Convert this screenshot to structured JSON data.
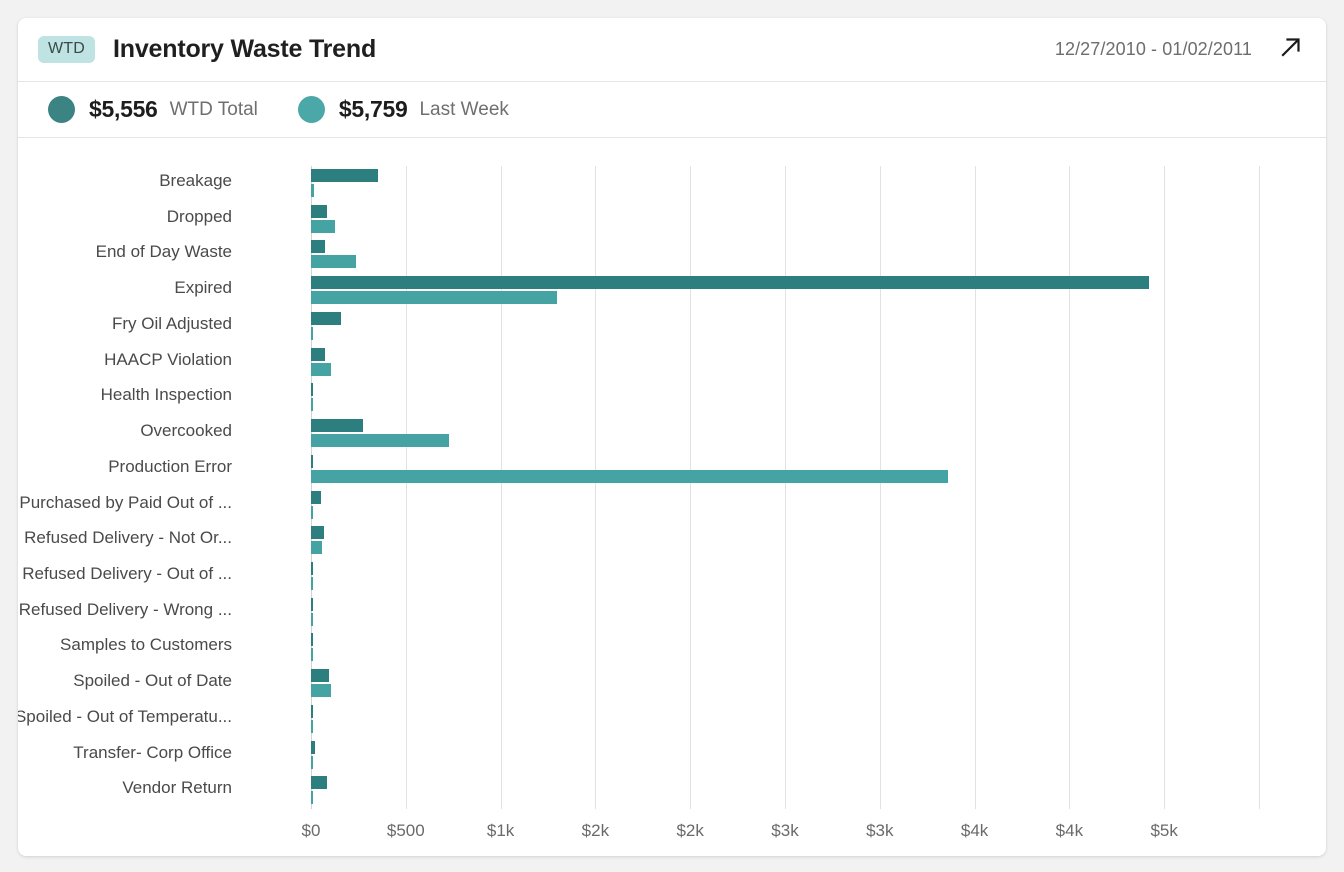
{
  "header": {
    "badge": "WTD",
    "title": "Inventory Waste Trend",
    "date_range": "12/27/2010 - 01/02/2011",
    "expand_icon": "arrow-up-right-icon"
  },
  "legend": [
    {
      "value": "$5,556",
      "label": "WTD Total",
      "color": "#3c8383",
      "icon": "legend-dot-icon"
    },
    {
      "value": "$5,759",
      "label": "Last Week",
      "color": "#4ca8a8",
      "icon": "legend-dot-icon"
    }
  ],
  "colors": {
    "wtd_bar": "#2d7f7f",
    "prev_bar": "#46a3a3",
    "badge_bg": "#bfe2e2",
    "gridline": "#e2e2e2"
  },
  "chart_data": {
    "type": "bar",
    "orientation": "horizontal",
    "title": "Inventory Waste Trend",
    "xlabel": "",
    "ylabel": "",
    "xlim": [
      0,
      5000
    ],
    "grid": true,
    "legend_position": "top-left",
    "tick_values": [
      0,
      500,
      1000,
      1500,
      2000,
      2500,
      3000,
      3500,
      4000,
      4500,
      5000
    ],
    "tick_labels": [
      "$0",
      "$500",
      "$1k",
      "$2k",
      "$2k",
      "$3k",
      "$3k",
      "$4k",
      "$4k",
      "$5k"
    ],
    "categories": [
      "Breakage",
      "Dropped",
      "End of Day Waste",
      "Expired",
      "Fry Oil Adjusted",
      "HAACP Violation",
      "Health Inspection",
      "Overcooked",
      "Production Error",
      "Purchased by Paid Out of ...",
      "Refused Delivery - Not Or...",
      "Refused Delivery - Out of ...",
      "Refused Delivery - Wrong ...",
      "Samples to Customers",
      "Spoiled - Out of Date",
      "Spoiled - Out of Temperatu...",
      "Transfer- Corp Office",
      "Vendor Return"
    ],
    "series": [
      {
        "name": "WTD Total",
        "color": "#2d7f7f",
        "values": [
          355,
          85,
          75,
          4420,
          160,
          75,
          0,
          275,
          5,
          55,
          70,
          8,
          0,
          0,
          95,
          0,
          20,
          85
        ]
      },
      {
        "name": "Last Week",
        "color": "#46a3a3",
        "values": [
          15,
          125,
          235,
          1300,
          0,
          105,
          10,
          730,
          3360,
          0,
          60,
          10,
          10,
          10,
          105,
          10,
          0,
          0
        ]
      }
    ]
  }
}
